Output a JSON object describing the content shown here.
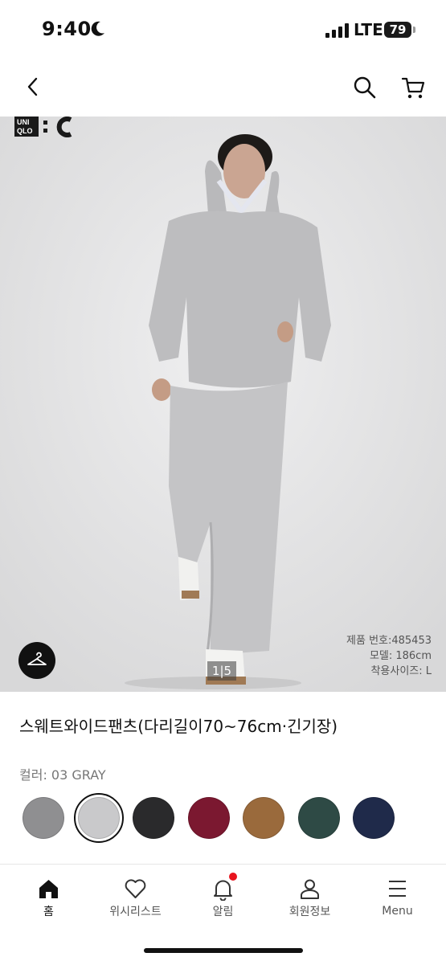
{
  "status": {
    "time": "9:40",
    "network": "LTE",
    "battery": "79"
  },
  "icons": {
    "back": "back-chevron-icon",
    "search": "search-icon",
    "cart": "cart-icon",
    "hanger": "hanger-icon",
    "moon": "moon-icon",
    "signal": "signal-icon"
  },
  "brand": {
    "logo_top": "UNI",
    "logo_bottom": "QLO",
    "logo_suffix": ":C"
  },
  "gallery": {
    "page": "1|5"
  },
  "meta": {
    "product_no": "제품 번호:485453",
    "model": "모델: 186cm",
    "size_worn": "착용사이즈: L"
  },
  "product": {
    "title": "스웨트와이드팬츠(다리길이70~76cm·긴기장)",
    "color_label": "컬러: 03 GRAY"
  },
  "colors": {
    "swatches": [
      "#8f8f91",
      "#c9c9cb",
      "#2a2a2c",
      "#7b1830",
      "#9a6a3c",
      "#2e4a45",
      "#1f2a4a"
    ],
    "selected_index": 1,
    "badge": "#e8141e"
  },
  "nav": {
    "tabs": [
      {
        "label": "홈",
        "icon": "home-icon"
      },
      {
        "label": "위시리스트",
        "icon": "heart-icon"
      },
      {
        "label": "알림",
        "icon": "bell-icon"
      },
      {
        "label": "회원정보",
        "icon": "user-icon"
      },
      {
        "label": "Menu",
        "icon": "menu-icon"
      }
    ]
  }
}
